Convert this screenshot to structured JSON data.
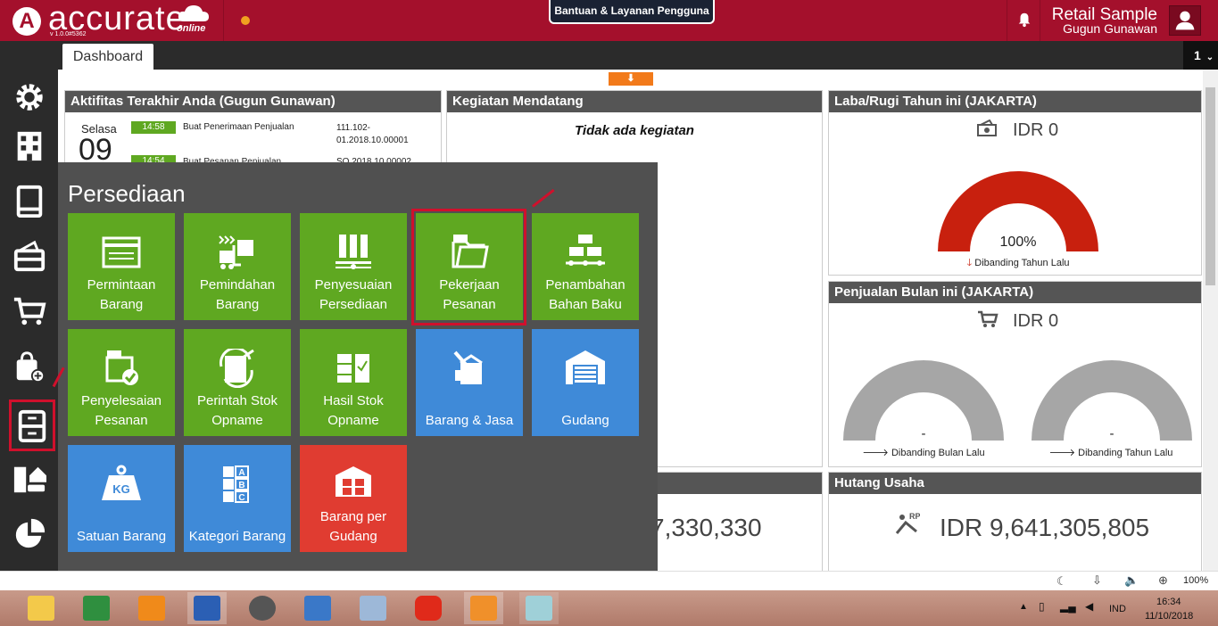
{
  "header": {
    "logo_letter": "A",
    "logo_text": "accurate",
    "logo_sub": "online",
    "version": "v 1.0.0#5362",
    "help_button": "Bantuan & Layanan Pengguna",
    "company": "Retail Sample",
    "user": "Gugun Gunawan",
    "status_dot_color": "#f0a020",
    "brand_color": "#a4102c"
  },
  "tabs": {
    "dashboard": "Dashboard",
    "count": "1"
  },
  "collapse_arrow": "⬇",
  "activity_panel": {
    "title": "Aktifitas Terakhir Anda (Gugun Gunawan)",
    "day": "Selasa",
    "date": "09",
    "rows": [
      {
        "time": "14:58",
        "action": "Buat Penerimaan Penjualan",
        "ref": "111.102-01.2018.10.00001"
      },
      {
        "time": "14:54",
        "action": "Buat Pesanan Penjualan",
        "ref": "SO.2018.10.00002"
      }
    ]
  },
  "upcoming_panel": {
    "title": "Kegiatan Mendatang",
    "empty_text": "Tidak ada kegiatan"
  },
  "profit_panel": {
    "title": "Laba/Rugi Tahun ini (JAKARTA)",
    "amount": "IDR 0",
    "gauge_percent": "100%",
    "compare": "Dibanding Tahun Lalu"
  },
  "sales_panel": {
    "title": "Penjualan Bulan ini (JAKARTA)",
    "amount": "IDR 0",
    "gauge1_value": "-",
    "gauge1_compare": "Dibanding Bulan Lalu",
    "gauge2_value": "-",
    "gauge2_compare": "Dibanding Tahun Lalu"
  },
  "receivable_panel": {
    "amount": "7,330,330"
  },
  "payable_panel": {
    "title": "Hutang Usaha",
    "amount": "IDR 9,641,305,805"
  },
  "menu": {
    "title": "Persediaan",
    "tiles": [
      {
        "label": "Permintaan Barang",
        "icon": "form-icon",
        "color": "green"
      },
      {
        "label": "Pemindahan Barang",
        "icon": "forklift-icon",
        "color": "green"
      },
      {
        "label": "Penyesuaian Persediaan",
        "icon": "adjust-icon",
        "color": "green"
      },
      {
        "label": "Pekerjaan Pesanan",
        "icon": "job-folder-icon",
        "color": "green"
      },
      {
        "label": "Penambahan Bahan Baku",
        "icon": "boxes-icon",
        "color": "green"
      },
      {
        "label": "Penyelesaian Pesanan",
        "icon": "job-check-icon",
        "color": "green"
      },
      {
        "label": "Perintah Stok Opname",
        "icon": "stock-order-icon",
        "color": "green"
      },
      {
        "label": "Hasil Stok Opname",
        "icon": "stock-result-icon",
        "color": "green"
      },
      {
        "label": "Barang & Jasa",
        "icon": "box-hand-icon",
        "color": "blue"
      },
      {
        "label": "Gudang",
        "icon": "warehouse-icon",
        "color": "blue"
      },
      {
        "label": "Satuan Barang",
        "icon": "weight-icon",
        "color": "blue"
      },
      {
        "label": "Kategori Barang",
        "icon": "abc-icon",
        "color": "blue"
      },
      {
        "label": "Barang per Gudang",
        "icon": "warehouse-items-icon",
        "color": "red"
      }
    ]
  },
  "statusbar": {
    "zoom": "100%"
  },
  "taskbar": {
    "lang": "IND",
    "time": "16:34",
    "date": "11/10/2018"
  }
}
